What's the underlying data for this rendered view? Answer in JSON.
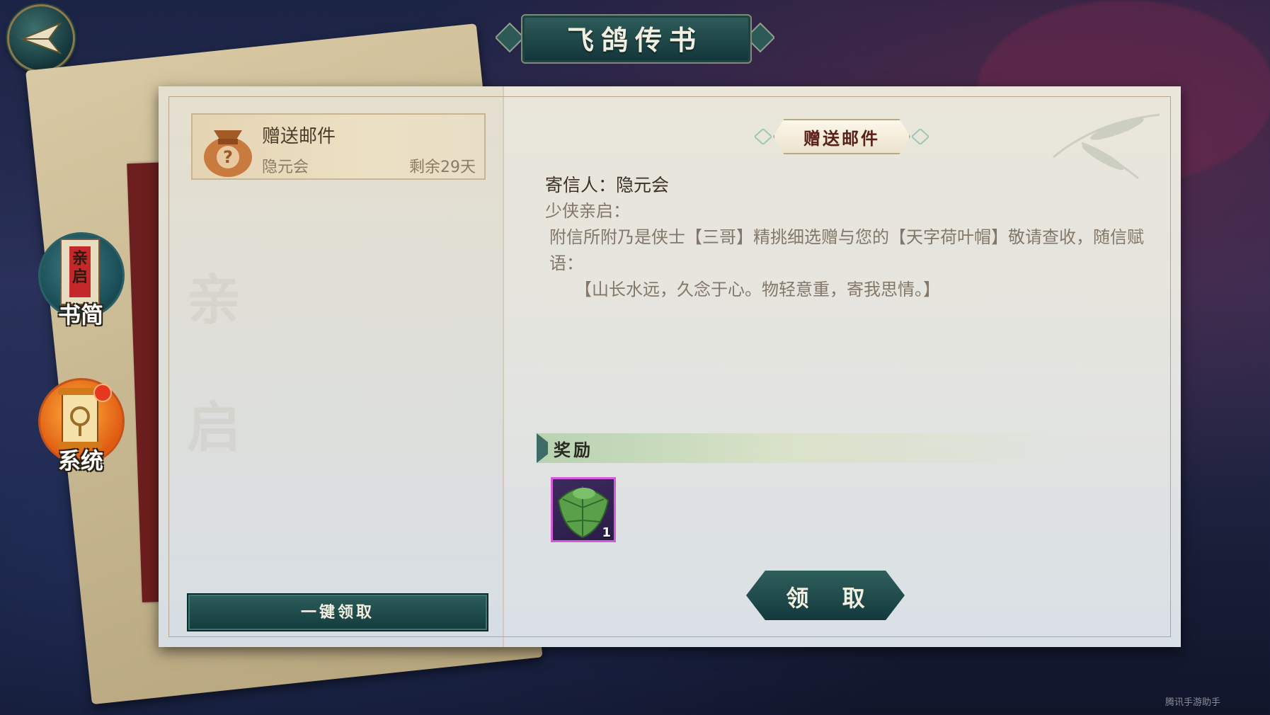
{
  "window": {
    "title": "飞鸽传书"
  },
  "sidebar": {
    "tabs": [
      {
        "label": "书简",
        "badge_text": "亲启"
      },
      {
        "label": "系统"
      }
    ]
  },
  "mail_list": {
    "items": [
      {
        "title": "赠送邮件",
        "sender": "隐元会",
        "remaining": "剩余29天"
      }
    ],
    "claim_all_label": "一键领取"
  },
  "mail_detail": {
    "subject": "赠送邮件",
    "sender_line": "寄信人：隐元会",
    "greeting": "少侠亲启：",
    "body_line1": "附信所附乃是侠士【三哥】精挑细选赠与您的【天字荷叶帽】敬请查收，随信赋语：",
    "body_line2": "【山长水远，久念于心。物轻意重，寄我思情。】",
    "reward_header": "奖励",
    "reward_items": [
      {
        "icon": "lotus-leaf-hat-icon",
        "count": "1"
      }
    ],
    "claim_label": "领 取"
  },
  "footer": {
    "watermark": "腾讯手游助手"
  },
  "colors": {
    "accent_teal": "#1f4a4a",
    "paper": "#e6e3d8",
    "reward_border": "#d35ad8"
  }
}
